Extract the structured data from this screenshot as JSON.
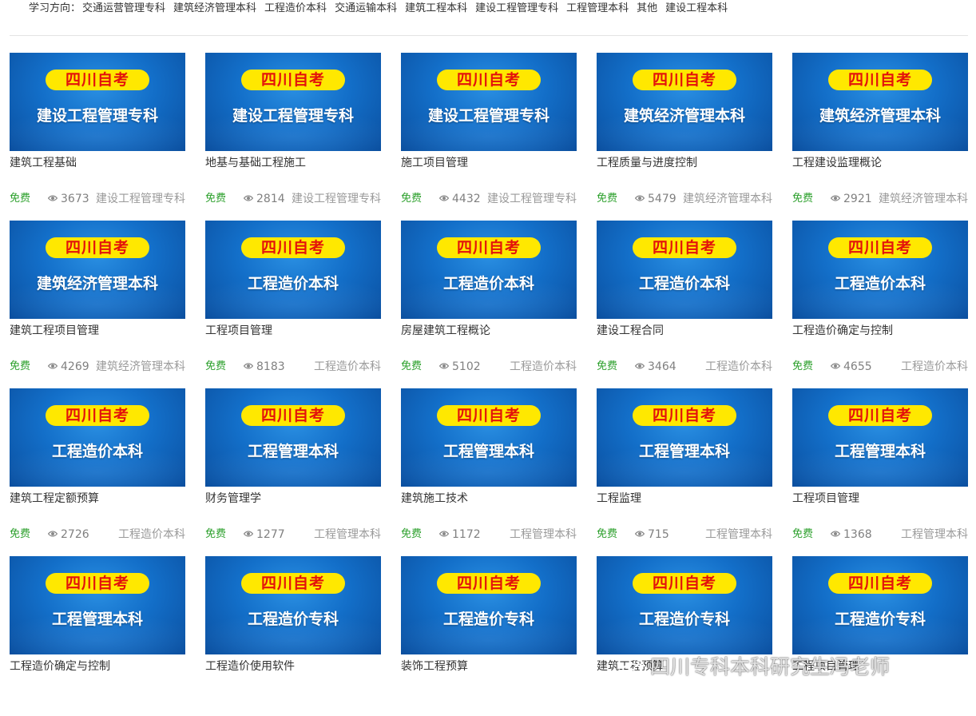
{
  "filter": {
    "label": "学习方向：",
    "items": [
      "交通运营管理专科",
      "建筑经济管理本科",
      "工程造价本科",
      "交通运输本科",
      "建筑工程本科",
      "建设工程管理专科",
      "工程管理本科",
      "其他",
      "建设工程本科"
    ]
  },
  "colors": {
    "thumb_blue": "#136fc9",
    "pill_yellow": "#ffe800",
    "pill_red": "#e3120b",
    "free_green": "#2ca02c"
  },
  "cards": [
    {
      "banner": "四川自考",
      "major": "建设工程管理专科",
      "title": "建筑工程基础",
      "free": "免费",
      "views": "3673",
      "tag": "建设工程管理专科"
    },
    {
      "banner": "四川自考",
      "major": "建设工程管理专科",
      "title": "地基与基础工程施工",
      "free": "免费",
      "views": "2814",
      "tag": "建设工程管理专科"
    },
    {
      "banner": "四川自考",
      "major": "建设工程管理专科",
      "title": "施工项目管理",
      "free": "免费",
      "views": "4432",
      "tag": "建设工程管理专科"
    },
    {
      "banner": "四川自考",
      "major": "建筑经济管理本科",
      "title": "工程质量与进度控制",
      "free": "免费",
      "views": "5479",
      "tag": "建筑经济管理本科"
    },
    {
      "banner": "四川自考",
      "major": "建筑经济管理本科",
      "title": "工程建设监理概论",
      "free": "免费",
      "views": "2921",
      "tag": "建筑经济管理本科"
    },
    {
      "banner": "四川自考",
      "major": "建筑经济管理本科",
      "title": "建筑工程项目管理",
      "free": "免费",
      "views": "4269",
      "tag": "建筑经济管理本科"
    },
    {
      "banner": "四川自考",
      "major": "工程造价本科",
      "title": "工程项目管理",
      "free": "免费",
      "views": "8183",
      "tag": "工程造价本科"
    },
    {
      "banner": "四川自考",
      "major": "工程造价本科",
      "title": "房屋建筑工程概论",
      "free": "免费",
      "views": "5102",
      "tag": "工程造价本科"
    },
    {
      "banner": "四川自考",
      "major": "工程造价本科",
      "title": "建设工程合同",
      "free": "免费",
      "views": "3464",
      "tag": "工程造价本科"
    },
    {
      "banner": "四川自考",
      "major": "工程造价本科",
      "title": "工程造价确定与控制",
      "free": "免费",
      "views": "4655",
      "tag": "工程造价本科"
    },
    {
      "banner": "四川自考",
      "major": "工程造价本科",
      "title": "建筑工程定额预算",
      "free": "免费",
      "views": "2726",
      "tag": "工程造价本科"
    },
    {
      "banner": "四川自考",
      "major": "工程管理本科",
      "title": "财务管理学",
      "free": "免费",
      "views": "1277",
      "tag": "工程管理本科"
    },
    {
      "banner": "四川自考",
      "major": "工程管理本科",
      "title": "建筑施工技术",
      "free": "免费",
      "views": "1172",
      "tag": "工程管理本科"
    },
    {
      "banner": "四川自考",
      "major": "工程管理本科",
      "title": "工程监理",
      "free": "免费",
      "views": "715",
      "tag": "工程管理本科"
    },
    {
      "banner": "四川自考",
      "major": "工程管理本科",
      "title": "工程项目管理",
      "free": "免费",
      "views": "1368",
      "tag": "工程管理本科"
    },
    {
      "banner": "四川自考",
      "major": "工程管理本科",
      "title": "工程造价确定与控制",
      "free": "",
      "views": "",
      "tag": ""
    },
    {
      "banner": "四川自考",
      "major": "工程造价专科",
      "title": "工程造价使用软件",
      "free": "",
      "views": "",
      "tag": ""
    },
    {
      "banner": "四川自考",
      "major": "工程造价专科",
      "title": "装饰工程预算",
      "free": "",
      "views": "",
      "tag": ""
    },
    {
      "banner": "四川自考",
      "major": "工程造价专科",
      "title": "建筑工程预算",
      "free": "",
      "views": "",
      "tag": ""
    },
    {
      "banner": "四川自考",
      "major": "工程造价专科",
      "title": "工程项目管理",
      "free": "",
      "views": "",
      "tag": ""
    }
  ],
  "watermark": {
    "text": "四川专科本科研究生冯老师",
    "icon": "weibo-icon"
  }
}
